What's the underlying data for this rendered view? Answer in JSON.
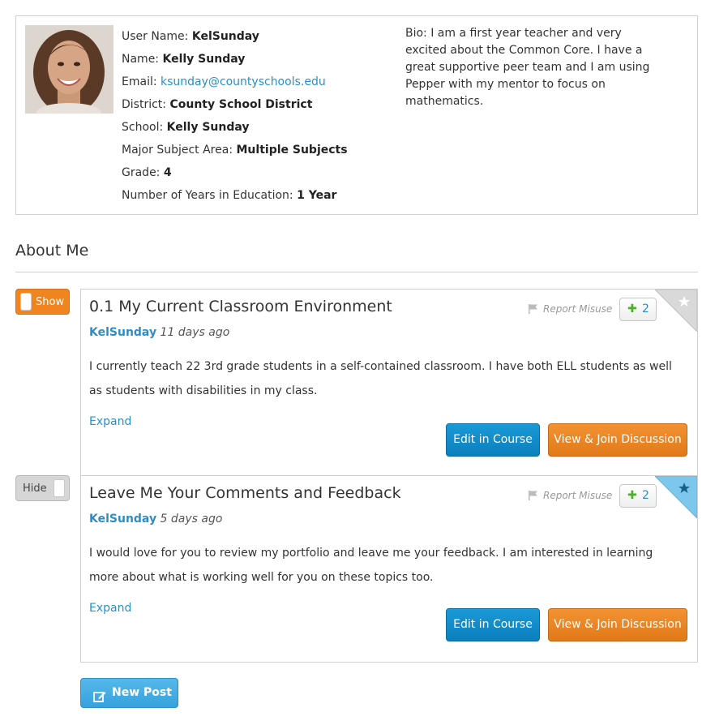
{
  "profile": {
    "user_name_label": "User Name:",
    "user_name": "KelSunday",
    "name_label": "Name:",
    "name": "Kelly Sunday",
    "email_label": "Email:",
    "email": "ksunday@countyschools.edu",
    "district_label": "District:",
    "district": "County School District",
    "school_label": "School:",
    "school": "Kelly Sunday",
    "subject_label": "Major Subject Area:",
    "subject": "Multiple Subjects",
    "grade_label": "Grade:",
    "grade": "4",
    "years_label": "Number of Years in Education:",
    "years": "1 Year",
    "bio": "Bio: I am a first year teacher and very excited about the Common Core. I have a great supportive peer team and I am using Pepper with my mentor to focus on mathematics."
  },
  "section": {
    "title": "About Me"
  },
  "posts": [
    {
      "toggle_label": "Show",
      "title": "0.1 My Current Classroom Environment",
      "author": "KelSunday",
      "time": "11 days ago",
      "body": "I currently teach 22 3rd grade students in a self-contained classroom. I have both ELL students as well as students with disabilities in my class.",
      "expand": "Expand",
      "report": "Report Misuse",
      "plus_count": "2",
      "edit_label": "Edit in Course",
      "view_label": "View & Join Discussion",
      "starred": false
    },
    {
      "toggle_label": "Hide",
      "title": "Leave Me Your Comments and Feedback",
      "author": "KelSunday",
      "time": "5 days ago",
      "body": "I would love for you to review my portfolio and leave me your feedback. I am interested in learning more about what is working well for you on these topics too.",
      "expand": "Expand",
      "report": "Report Misuse",
      "plus_count": "2",
      "edit_label": "Edit in Course",
      "view_label": "View & Join Discussion",
      "starred": true
    }
  ],
  "new_post": {
    "label": "New Post"
  },
  "colors": {
    "link": "#2a8fc9",
    "orange": "#f0851f",
    "blue_button": "#0b7fbd",
    "star_active": "#7cc8ec",
    "star_inactive": "#cccccc"
  },
  "icons": {
    "flag": "flag-icon",
    "plus": "plus-icon",
    "star": "star-icon",
    "edit": "edit-icon"
  }
}
